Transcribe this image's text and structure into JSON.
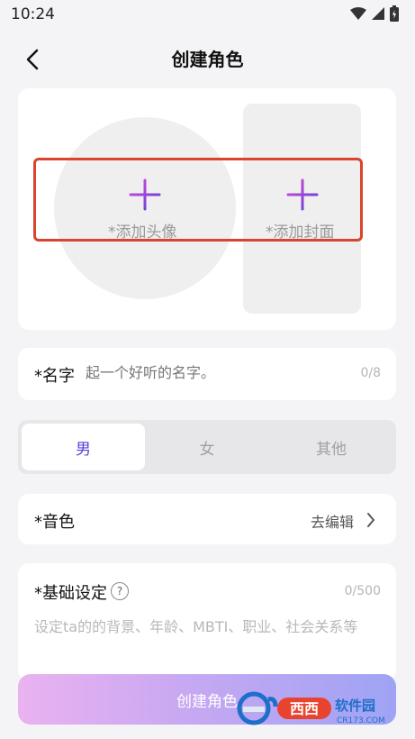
{
  "status_bar": {
    "time": "10:24"
  },
  "header": {
    "title": "创建角色",
    "back_icon": "back-arrow-icon"
  },
  "media": {
    "avatar_label": "*添加头像",
    "cover_label": "*添加封面",
    "plus_icon": "plus-icon",
    "highlight_color": "#d9442e"
  },
  "name": {
    "label": "*名字",
    "placeholder": "起一个好听的名字。",
    "count": "0/8"
  },
  "gender": {
    "options": [
      "男",
      "女",
      "其他"
    ],
    "selected": "男"
  },
  "voice": {
    "label": "*音色",
    "action": "去编辑"
  },
  "basic_settings": {
    "label": "*基础设定",
    "help": "?",
    "count": "0/500",
    "placeholder": "设定ta的的背景、年龄、MBTI、职业、社会关系等"
  },
  "create_button": {
    "label": "创建角色"
  },
  "watermark": {
    "brand": "西西软件园",
    "url": "CR173.COM"
  },
  "colors": {
    "accent": "#5b3fd6",
    "plus_gradient": [
      "#d94cd8",
      "#5b3fd6"
    ]
  }
}
